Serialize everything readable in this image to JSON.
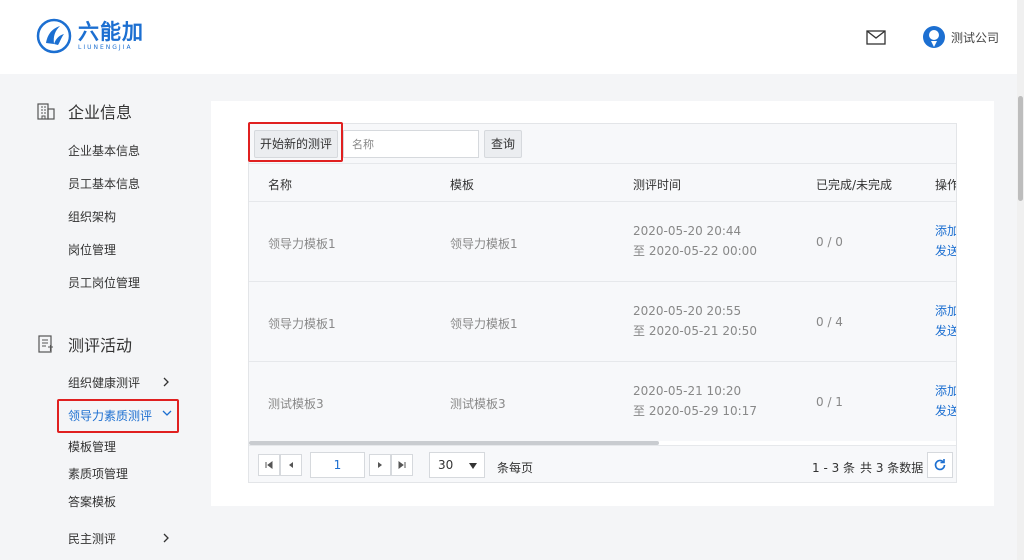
{
  "header": {
    "logo_cn": "六能加",
    "logo_en": "LIUNENGJIA",
    "company": "测试公司"
  },
  "sidebar": {
    "section1": {
      "title": "企业信息",
      "items": [
        "企业基本信息",
        "员工基本信息",
        "组织架构",
        "岗位管理",
        "员工岗位管理"
      ]
    },
    "section2": {
      "title": "测评活动",
      "items": [
        {
          "label": "组织健康测评",
          "expanded": false
        },
        {
          "label": "领导力素质测评",
          "expanded": true,
          "active": true
        }
      ],
      "subitems": [
        "模板管理",
        "素质项管理",
        "答案模板"
      ],
      "last": {
        "label": "民主测评",
        "expanded": false
      }
    }
  },
  "toolbar": {
    "start_label": "开始新的测评",
    "search_placeholder": "名称",
    "query_label": "查询"
  },
  "table": {
    "headers": [
      "名称",
      "模板",
      "测评时间",
      "已完成/未完成",
      "操作"
    ],
    "rows": [
      {
        "name": "领导力模板1",
        "template": "领导力模板1",
        "time_start": "2020-05-20 20:44",
        "time_end": "至 2020-05-22 00:00",
        "status": "0 / 0",
        "action1": "添加",
        "action2": "发送"
      },
      {
        "name": "领导力模板1",
        "template": "领导力模板1",
        "time_start": "2020-05-20 20:55",
        "time_end": "至 2020-05-21 20:50",
        "status": "0 / 4",
        "action1": "添加",
        "action2": "发送"
      },
      {
        "name": "测试模板3",
        "template": "测试模板3",
        "time_start": "2020-05-21 10:20",
        "time_end": "至 2020-05-29 10:17",
        "status": "0 / 1",
        "action1": "添加",
        "action2": "发送"
      }
    ]
  },
  "pager": {
    "page": "1",
    "page_size": "30",
    "per_page_label": "条每页",
    "range": "1 - 3 条",
    "total": "共 3 条数据"
  },
  "colors": {
    "accent": "#1c6fd1",
    "highlight": "#e02020"
  }
}
